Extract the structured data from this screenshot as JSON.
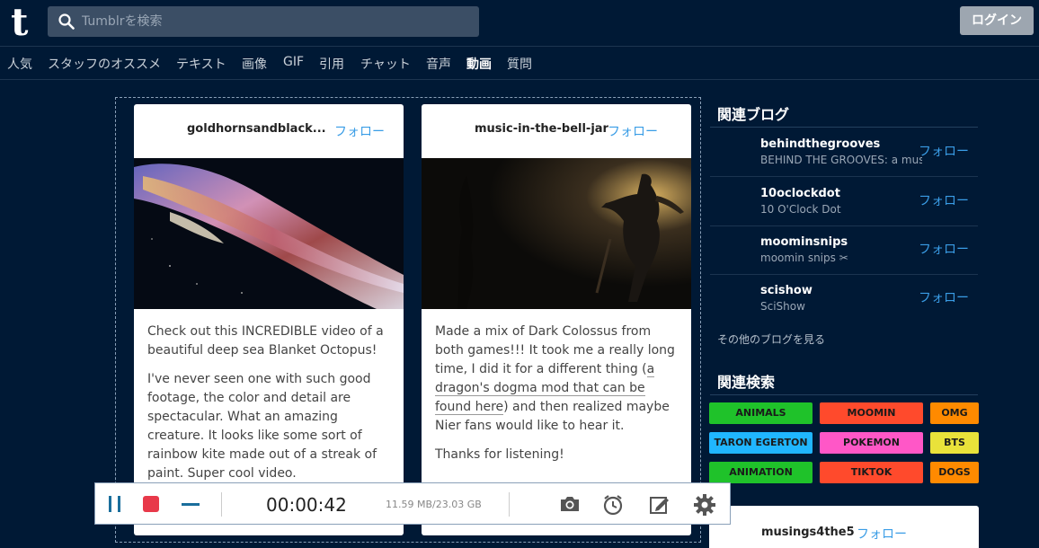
{
  "header": {
    "logo": "t",
    "search_placeholder": "Tumblrを検索",
    "login_label": "ログイン"
  },
  "nav": [
    {
      "label": "人気"
    },
    {
      "label": "スタッフのオススメ"
    },
    {
      "label": "テキスト"
    },
    {
      "label": "画像"
    },
    {
      "label": "GIF"
    },
    {
      "label": "引用"
    },
    {
      "label": "チャット"
    },
    {
      "label": "音声"
    },
    {
      "label": "動画",
      "active": true
    },
    {
      "label": "質問"
    }
  ],
  "posts": [
    {
      "author": "goldhornsandblack...",
      "follow": "フォロー",
      "paragraphs": [
        "Check out this INCREDIBLE video of a beautiful deep sea Blanket Octopus!",
        "I've never seen one with such good footage, the color and detail are spectacular. What an amazing creature. It looks like some sort of rainbow kite made out of a streak of paint. Super cool video."
      ]
    },
    {
      "author": "music-in-the-bell-jar",
      "follow": "フォロー",
      "p1_before": "Made a mix of Dark Colossus from both games!!! It took me a really long time, I did it for a different thing (",
      "p1_link": "a dragon's dogma mod that can be found here",
      "p1_after": ") and then realized maybe Nier fans would like to hear it.",
      "p2": "Thanks for listening!"
    }
  ],
  "sidebar": {
    "related_blogs_title": "関連ブログ",
    "blogs": [
      {
        "name": "behindthegrooves",
        "desc": "BEHIND THE GROOVES: a music",
        "follow": "フォロー"
      },
      {
        "name": "10oclockdot",
        "desc": "10 O'Clock Dot",
        "follow": "フォロー"
      },
      {
        "name": "moominsnips",
        "desc": "moomin snips ✂",
        "follow": "フォロー"
      },
      {
        "name": "scishow",
        "desc": "SciShow",
        "follow": "フォロー"
      }
    ],
    "more_blogs": "その他のブログを見る",
    "related_search_title": "関連検索",
    "tags": [
      {
        "label": "ANIMALS",
        "color": "#1fc22a"
      },
      {
        "label": "MOOMIN",
        "color": "#ff4a2c"
      },
      {
        "label": "OMG",
        "color": "#ff8a00"
      },
      {
        "label": "TARON EGERTON",
        "color": "#20b6ff"
      },
      {
        "label": "POKEMON",
        "color": "#ff57c7"
      },
      {
        "label": "BTS",
        "color": "#e9e23a"
      },
      {
        "label": "ANIMATION",
        "color": "#1fc22a"
      },
      {
        "label": "TIKTOK",
        "color": "#ff4a2c"
      },
      {
        "label": "DOGS",
        "color": "#ff8a00"
      }
    ],
    "bottom_card": {
      "name": "musings4the5",
      "follow": "フォロー"
    }
  },
  "recorder": {
    "time": "00:00:42",
    "size": "11.59 MB/23.03 GB",
    "icons": [
      "pause-icon",
      "stop-icon",
      "minimize-icon",
      "camera-icon",
      "schedule-icon",
      "edit-icon",
      "settings-icon"
    ]
  },
  "colors": {
    "background": "#001935",
    "accent": "#3a9de6",
    "record_red": "#e8394a",
    "recorder_blue": "#1a6e9c"
  }
}
